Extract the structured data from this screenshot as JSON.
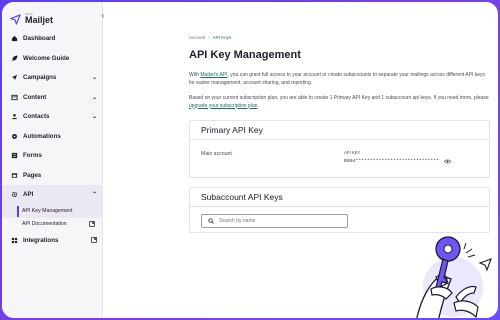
{
  "logo": {
    "small_text": "Sinch",
    "name": "Mailjet",
    "icon": "paper-plane-icon"
  },
  "sidebar": {
    "collapse_icon": "chevron-left-icon",
    "items": [
      {
        "label": "Dashboard",
        "icon": "home-icon"
      },
      {
        "label": "Welcome Guide",
        "icon": "rocket-icon"
      },
      {
        "label": "Campaigns",
        "icon": "send-icon",
        "chevron": "⌄"
      },
      {
        "label": "Content",
        "icon": "content-icon",
        "chevron": "⌄"
      },
      {
        "label": "Contacts",
        "icon": "contacts-icon",
        "chevron": "⌄"
      },
      {
        "label": "Automations",
        "icon": "automation-icon"
      },
      {
        "label": "Forms",
        "icon": "forms-icon"
      },
      {
        "label": "Pages",
        "icon": "pages-icon"
      },
      {
        "label": "API",
        "icon": "gear-icon",
        "chevron": "⌃"
      },
      {
        "label": "API Key Management"
      },
      {
        "label": "API Documentation"
      },
      {
        "label": "Integrations",
        "icon": "integrations-icon",
        "chevron": "⌄"
      }
    ]
  },
  "breadcrumb": {
    "root": "Account",
    "separator": "›",
    "current": "API Keys"
  },
  "page": {
    "title": "API Key Management",
    "p1_before": "With ",
    "p1_link": "Mailjet's API",
    "p1_after": ", you can grant full access to your account or create subaccounts to separate your mailings across different API keys for easier management, account sharing, and reporting.",
    "p2_before": "Based on your current subscription plan, you are able to create 1 Primary API Key and 1 subaccount api keys. If you need more, please ",
    "p2_link": "upgrade your subscription plan",
    "p2_after": "."
  },
  "primary": {
    "heading": "Primary API Key",
    "row_label": "Main account",
    "key_heading": "API KEY",
    "key_value": "B604*****************************"
  },
  "subaccount": {
    "heading": "Subaccount API Keys",
    "search_placeholder": "Search by name"
  },
  "colors": {
    "accent": "#5b3df0",
    "link": "#1f6b64",
    "illustration": "#6f55f2"
  }
}
